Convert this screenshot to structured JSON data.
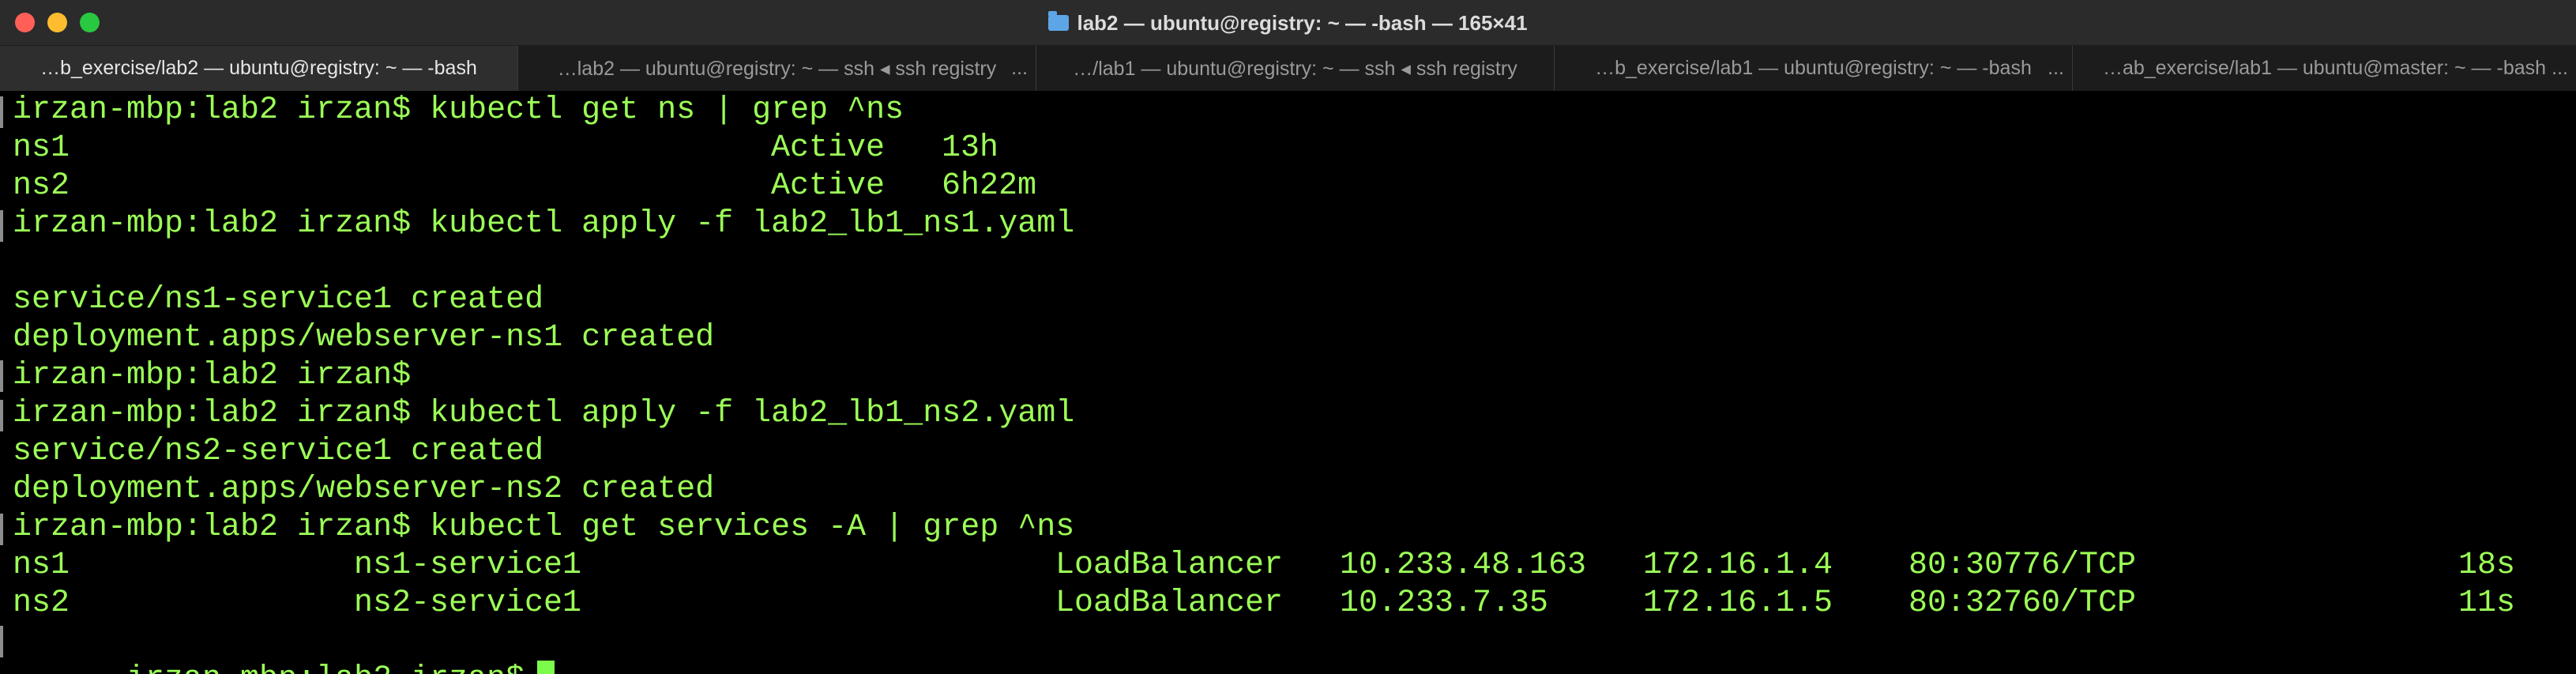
{
  "window": {
    "title": "lab2 — ubuntu@registry: ~ — -bash — 165×41"
  },
  "tabs": [
    {
      "label": "…b_exercise/lab2 — ubuntu@registry: ~ — -bash",
      "active": true
    },
    {
      "label": "…lab2 — ubuntu@registry: ~ — ssh ◂ ssh registry",
      "active": false
    },
    {
      "label": "…/lab1 — ubuntu@registry: ~ — ssh ◂ ssh registry",
      "active": false
    },
    {
      "label": "…b_exercise/lab1 — ubuntu@registry: ~ — -bash",
      "active": false
    },
    {
      "label": "…ab_exercise/lab1 — ubuntu@master: ~ — -bash",
      "active": false
    }
  ],
  "tab_overflow": "...",
  "terminal": {
    "lines": [
      "irzan-mbp:lab2 irzan$ kubectl get ns | grep ^ns",
      "",
      "",
      "irzan-mbp:lab2 irzan$ kubectl apply -f lab2_lb1_ns1.yaml",
      "",
      "service/ns1-service1 created",
      "deployment.apps/webserver-ns1 created",
      "irzan-mbp:lab2 irzan$",
      "irzan-mbp:lab2 irzan$ kubectl apply -f lab2_lb1_ns2.yaml",
      "service/ns2-service1 created",
      "deployment.apps/webserver-ns2 created",
      "irzan-mbp:lab2 irzan$ kubectl get services -A | grep ^ns",
      "",
      "",
      "irzan-mbp:lab2 irzan$"
    ],
    "ns_rows": [
      {
        "name": "ns1",
        "status": "Active",
        "age": "13h"
      },
      {
        "name": "ns2",
        "status": "Active",
        "age": "6h22m"
      }
    ],
    "svc_rows": [
      {
        "namespace": "ns1",
        "name": "ns1-service1",
        "type": "LoadBalancer",
        "cluster_ip": "10.233.48.163",
        "external_ip": "172.16.1.4",
        "ports": "80:30776/TCP",
        "age": "18s"
      },
      {
        "namespace": "ns2",
        "name": "ns2-service1",
        "type": "LoadBalancer",
        "cluster_ip": "10.233.7.35",
        "external_ip": "172.16.1.5",
        "ports": "80:32760/TCP",
        "age": "11s"
      }
    ]
  },
  "colors": {
    "terminal_text": "#9cff57",
    "terminal_bg": "#000000",
    "cursor": "#7cfc4a",
    "close": "#ff5f57",
    "minimize": "#febc2e",
    "maximize": "#28c840"
  }
}
